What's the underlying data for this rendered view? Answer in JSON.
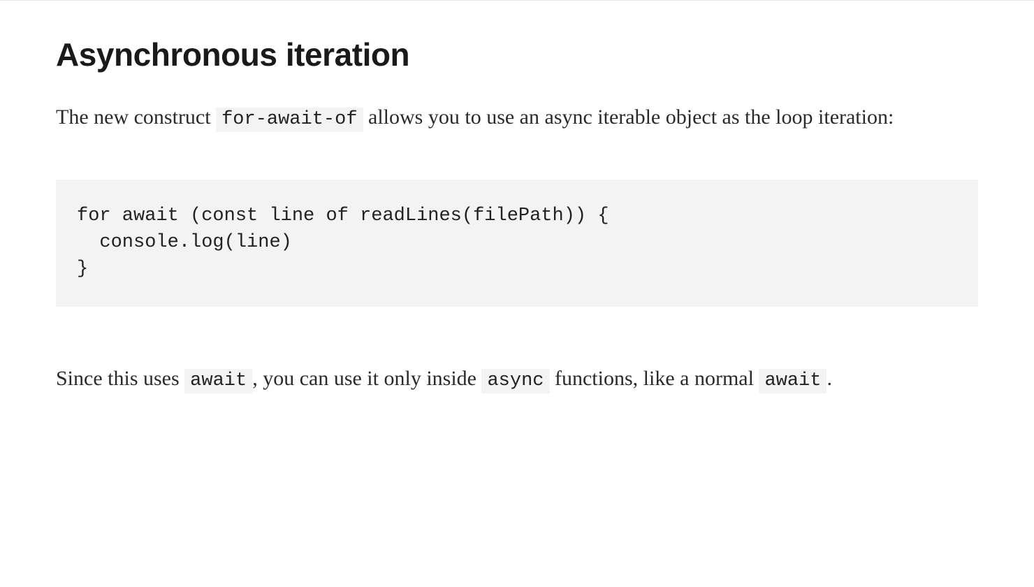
{
  "heading": "Asynchronous iteration",
  "para1": {
    "before": "The new construct ",
    "code": "for-await-of",
    "after": " allows you to use an async iterable object as the loop iteration:"
  },
  "code_block": "for await (const line of readLines(filePath)) {\n  console.log(line)\n}",
  "para2": {
    "seg1": "Since this uses ",
    "code1": "await",
    "seg2": ", you can use it only inside ",
    "code2": "async",
    "seg3": " functions, like a normal ",
    "code3": "await",
    "seg4": "."
  }
}
